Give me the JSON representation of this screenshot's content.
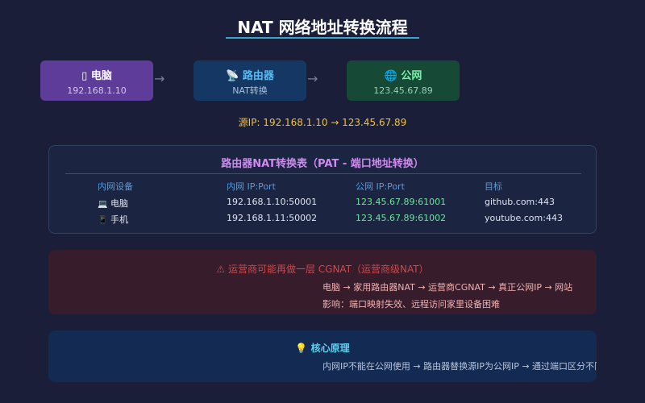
{
  "title": "NAT 网络地址转换流程",
  "flow": {
    "nodes": [
      {
        "icon": "laptop-icon",
        "glyph": "▯",
        "label": "电脑",
        "sub": "192.168.1.10"
      },
      {
        "icon": "router-icon",
        "glyph": "📡",
        "label": "路由器",
        "sub": "NAT转换"
      },
      {
        "icon": "globe-icon",
        "glyph": "🌐",
        "label": "公网",
        "sub": "123.45.67.89"
      }
    ],
    "arrow": "→"
  },
  "source_ip_text": "源IP: 192.168.1.10 → 123.45.67.89",
  "nat_table": {
    "title": "路由器NAT转换表（PAT - 端口地址转换）",
    "headers": [
      "内网设备",
      "内网 IP:Port",
      "公网 IP:Port",
      "目标"
    ],
    "rows": [
      {
        "icon": "computer-icon",
        "glyph": "💻",
        "device": "电脑",
        "private": "192.168.1.10:50001",
        "public": "123.45.67.89:61001",
        "target": "github.com:443"
      },
      {
        "icon": "phone-icon",
        "glyph": "📱",
        "device": "手机",
        "private": "192.168.1.11:50002",
        "public": "123.45.67.89:61002",
        "target": "youtube.com:443"
      }
    ]
  },
  "warning": {
    "icon": "warning-icon",
    "title": "⚠ 运营商可能再做一层 CGNAT（运营商级NAT）",
    "line1": "电脑 → 家用路由器NAT → 运营商CGNAT → 真正公网IP → 网站",
    "line2": "影响：端口映射失效、远程访问家里设备困难"
  },
  "core": {
    "icon": "lightbulb-icon",
    "glyph": "💡",
    "title": "核心原理",
    "line": "内网IP不能在公网使用 → 路由器替换源IP为公网IP → 通过端口区分不同设备"
  },
  "colors": {
    "background": "#1a1e38",
    "pc_node": "#5e3c9a",
    "router_node": "#143764",
    "internet_node": "#174a36",
    "source_ip": "#f0c040",
    "table_title": "#d08af0",
    "public_ip": "#6ee49c",
    "warning": "#cc4a4a",
    "core_title": "#5ed0f0"
  }
}
